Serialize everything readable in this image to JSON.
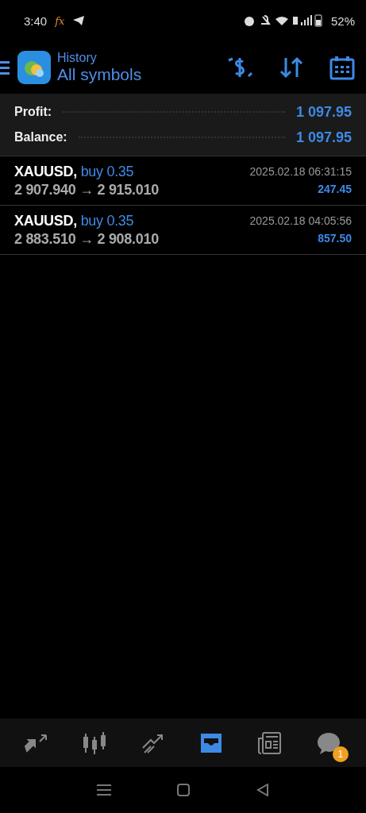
{
  "status_bar": {
    "time": "3:40",
    "app_mark": "fx",
    "battery": "52%"
  },
  "header": {
    "subtitle": "History",
    "title": "All symbols"
  },
  "summary": [
    {
      "label": "Profit:",
      "value": "1 097.95"
    },
    {
      "label": "Balance:",
      "value": "1 097.95"
    }
  ],
  "deals": [
    {
      "symbol": "XAUUSD,",
      "side": "buy 0.35",
      "prices": "2 907.940 → 2 915.010",
      "time": "2025.02.18 06:31:15",
      "profit": "247.45"
    },
    {
      "symbol": "XAUUSD,",
      "side": "buy 0.35",
      "prices": "2 883.510 → 2 908.010",
      "time": "2025.02.18 04:05:56",
      "profit": "857.50"
    }
  ],
  "tabs": [
    {
      "kind": "quotes",
      "selected": false
    },
    {
      "kind": "chart",
      "selected": false
    },
    {
      "kind": "trade",
      "selected": false
    },
    {
      "kind": "history",
      "selected": true
    },
    {
      "kind": "news",
      "selected": false
    },
    {
      "kind": "messages",
      "selected": false,
      "badge": "1"
    }
  ]
}
